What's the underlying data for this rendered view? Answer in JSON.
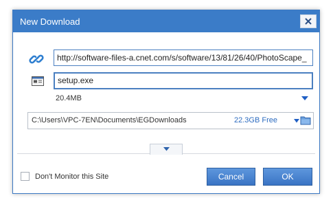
{
  "dialog": {
    "title": "New Download",
    "close_glyph": "×"
  },
  "url": {
    "value": "http://software-files-a.cnet.com/s/software/13/81/26/40/PhotoScape_",
    "icon": "link-icon"
  },
  "file": {
    "name": "setup.exe",
    "size": "20.4MB",
    "icon": "file-icon"
  },
  "folder": {
    "path": "C:\\Users\\VPC-7EN\\Documents\\EGDownloads",
    "free_space": "22.3GB Free",
    "icon": "folder-icon"
  },
  "options": {
    "dont_monitor_label": "Don't Monitor this Site",
    "dont_monitor_checked": false
  },
  "buttons": {
    "cancel_label": "Cancel",
    "ok_label": "OK"
  },
  "colors": {
    "accent": "#3b7cc8",
    "link_text": "#2d6cc0",
    "button": "#4a85d2"
  }
}
